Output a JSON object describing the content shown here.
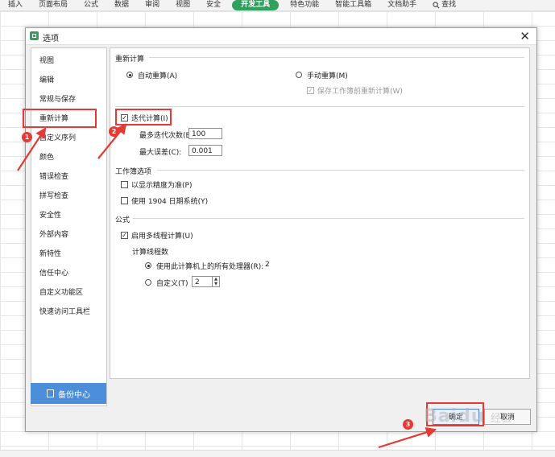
{
  "ribbon": {
    "tabs": [
      "插入",
      "页面布局",
      "公式",
      "数据",
      "审阅",
      "视图",
      "安全",
      "开发工具",
      "特色功能",
      "智能工具箱",
      "文档助手"
    ],
    "active_tab": "开发工具",
    "search_label": "查找"
  },
  "dialog": {
    "title": "选项",
    "nav": [
      "视图",
      "编辑",
      "常规与保存",
      "重新计算",
      "自定义序列",
      "颜色",
      "错误检查",
      "拼写检查",
      "安全性",
      "外部内容",
      "新特性",
      "信任中心",
      "自定义功能区",
      "快速访问工具栏"
    ],
    "selected_nav": "重新计算",
    "backup_label": "备份中心",
    "recalc": {
      "section_title": "重新计算",
      "auto_label": "自动重算(A)",
      "manual_label": "手动重算(M)",
      "save_before_label": "保存工作簿前重新计算(W)",
      "iterative_label": "迭代计算(I)",
      "max_iter_label": "最多迭代次数(E):",
      "max_iter_value": "100",
      "max_change_label": "最大误差(C):",
      "max_change_value": "0.001"
    },
    "workbook": {
      "section_title": "工作簿选项",
      "precision_label": "以显示精度为准(P)",
      "date1904_label": "使用 1904 日期系统(Y)"
    },
    "formula": {
      "section_title": "公式",
      "multithread_label": "启用多线程计算(U)",
      "threads_title": "计算线程数",
      "use_all_label": "使用此计算机上的所有处理器(R):",
      "use_all_count": "2",
      "custom_label": "自定义(T)",
      "custom_value": "2"
    },
    "ok_label": "确定",
    "cancel_label": "取消"
  },
  "annotations": {
    "step1": "1",
    "step2": "2",
    "step3": "3"
  },
  "watermark": {
    "text": "Baidu",
    "sub": "经验"
  },
  "colors": {
    "accent_green": "#2fa05e",
    "backup_blue": "#4c8ed9",
    "annotation_red": "#e53935"
  }
}
